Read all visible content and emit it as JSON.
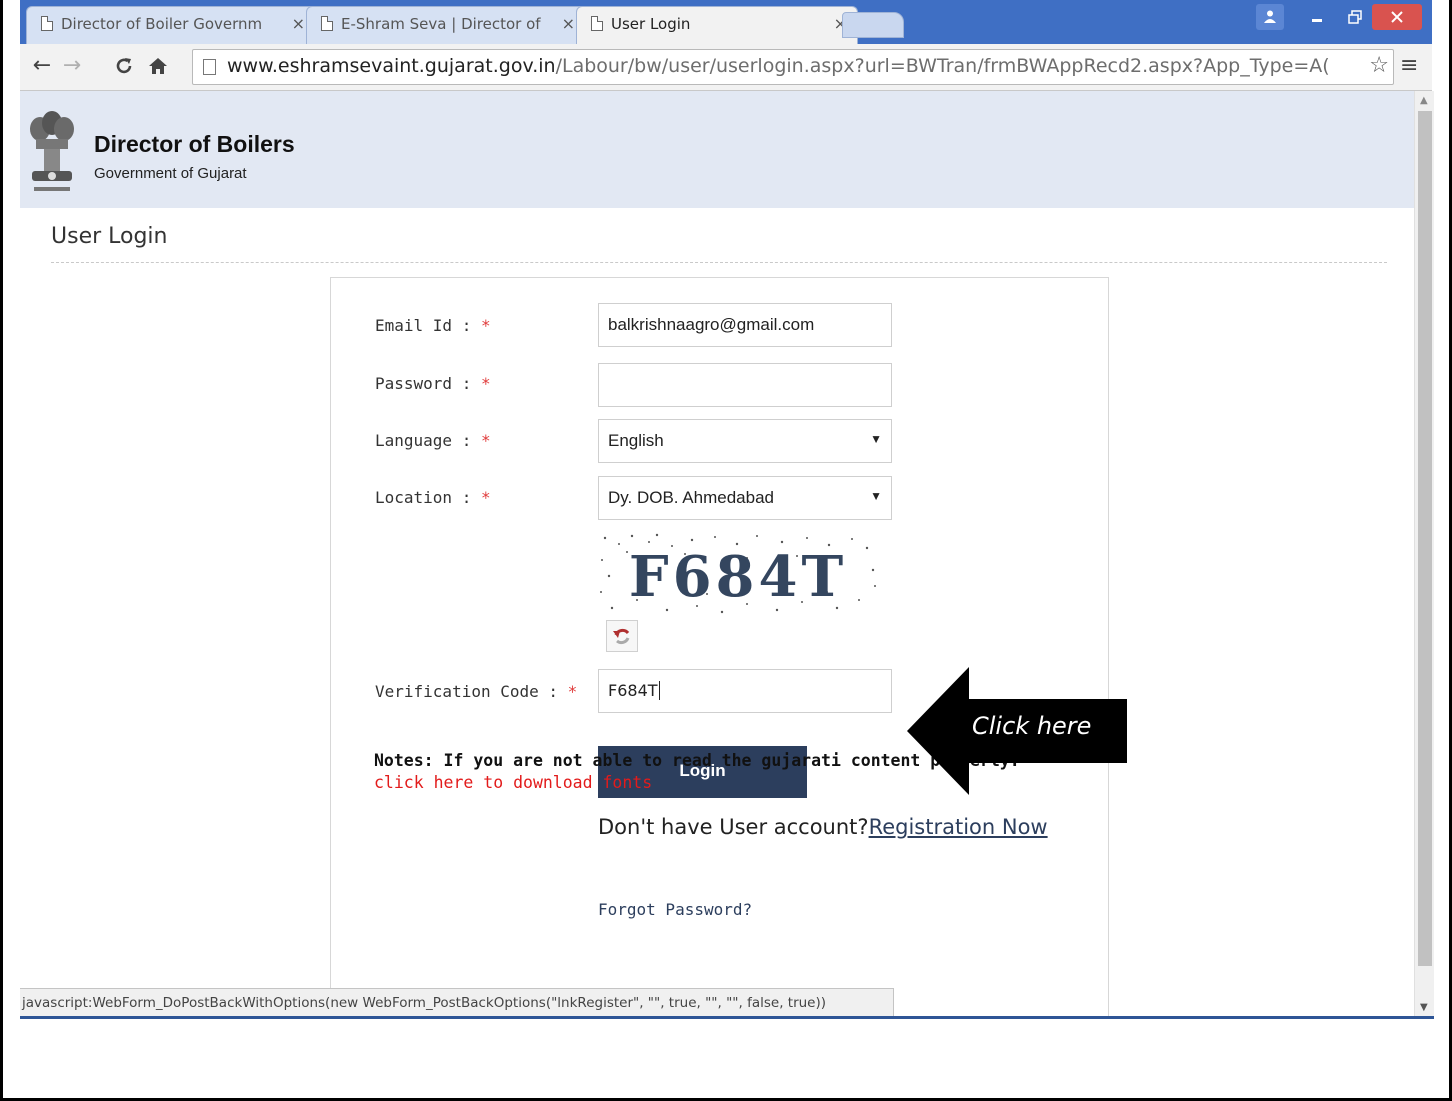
{
  "browser": {
    "tabs": [
      {
        "title": "Director of Boiler Governm",
        "active": false
      },
      {
        "title": "E-Shram Seva | Director of",
        "active": false
      },
      {
        "title": "User Login",
        "active": true
      }
    ],
    "close_glyph": "×",
    "url_host": "www.eshramsevaint.gujarat.gov.in",
    "url_path": "/Labour/bw/user/userlogin.aspx?url=BWTran/frmBWAppRecd2.aspx?App_Type=A(",
    "nav_icons": [
      "back-icon",
      "forward-icon",
      "reload-icon",
      "home-icon",
      "bookmark-star-icon",
      "menu-icon"
    ],
    "status_text": "javascript:WebForm_DoPostBackWithOptions(new WebForm_PostBackOptions(\"lnkRegister\", \"\", true, \"\", \"\", false, true))"
  },
  "header": {
    "title": "Director of Boilers",
    "subtitle": "Government of Gujarat",
    "bg_color": "#e2e8f3"
  },
  "page": {
    "heading": "User Login"
  },
  "form": {
    "email_label": "Email Id : ",
    "email_value": "balkrishnaagro@gmail.com",
    "password_label": "Password : ",
    "password_value": "",
    "language_label": "Language : ",
    "language_value": "English",
    "location_label": "Location : ",
    "location_value": "Dy. DOB. Ahmedabad",
    "captcha_text": "F684T",
    "verification_label": "Verification Code : ",
    "verification_value": "F684T",
    "required_mark": "*",
    "login_label": "Login",
    "login_color": "#2c3e5d",
    "register_prompt": "Don't have User account?",
    "register_link": "Registration Now",
    "forgot_link": "Forgot Password?",
    "notes": "Notes: If you are not able to read the gujarati content properly.",
    "fonts_link": "click here to download fonts"
  },
  "annotation": {
    "callout_text": "Click here"
  }
}
